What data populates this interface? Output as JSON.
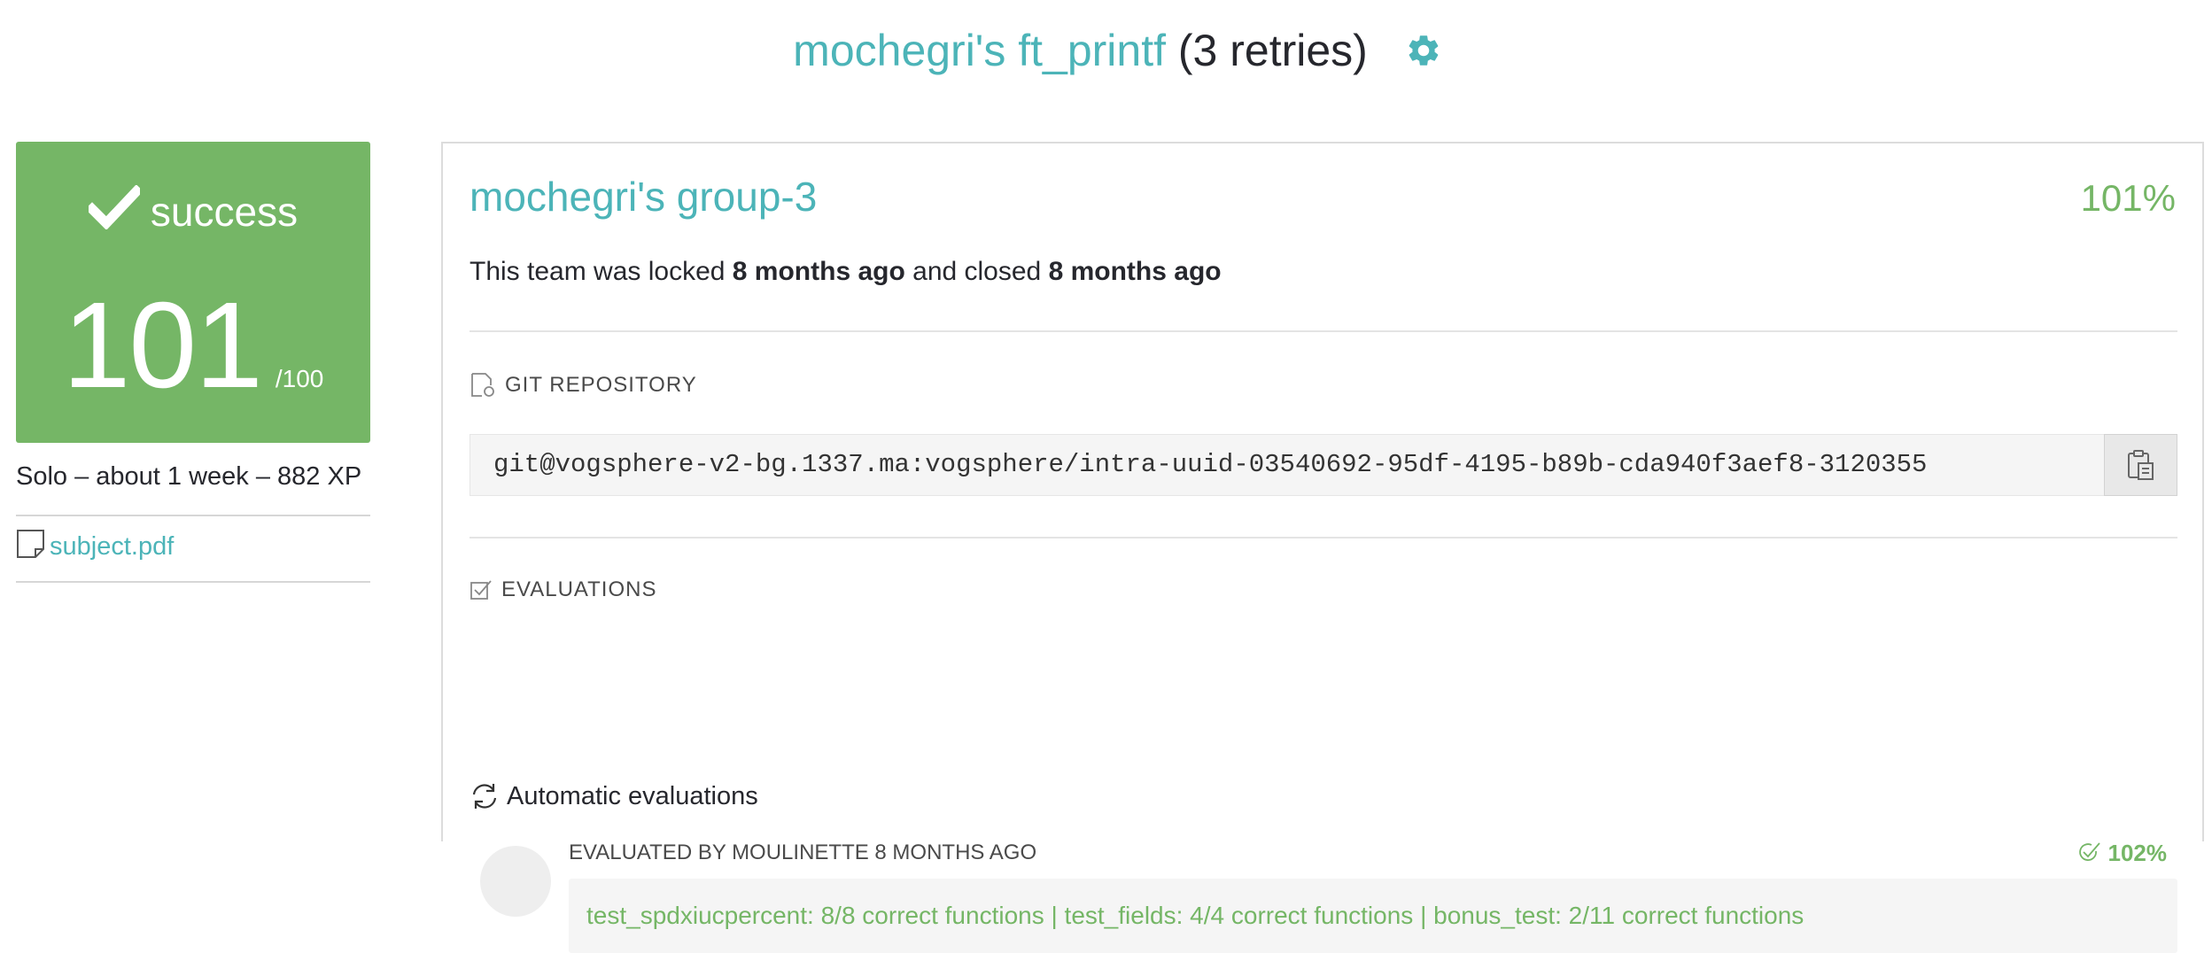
{
  "header": {
    "project_link": "mochegri's ft_printf",
    "retries": "(3 retries)",
    "settings_icon": "gear-icon",
    "accent_color": "#4cb4b8"
  },
  "status_card": {
    "status": "success",
    "status_icon": "checkmark-icon",
    "score": "101",
    "max_score": "/100",
    "background_color": "#75b666"
  },
  "project_info": {
    "summary": "Solo – about 1 week – 882 XP",
    "attachment_icon": "document-icon",
    "attachment_label": "subject.pdf"
  },
  "team": {
    "name": "mochegri's group-3",
    "final_percent": "101%",
    "status_prefix": "This team was locked ",
    "locked_time": "8 months ago",
    "status_middle": " and closed ",
    "closed_time": "8 months ago"
  },
  "git_section": {
    "heading": "GIT REPOSITORY",
    "heading_icon": "git-repo-icon",
    "repo_url": "git@vogsphere-v2-bg.1337.ma:vogsphere/intra-uuid-03540692-95df-4195-b89b-cda940f3aef8-3120355",
    "copy_icon": "clipboard-icon"
  },
  "evaluations_section": {
    "heading": "EVALUATIONS",
    "heading_icon": "checkbox-icon",
    "automatic_heading": "Automatic evaluations",
    "automatic_icon": "refresh-icon",
    "evaluation": {
      "evaluator_line": "EVALUATED BY MOULINETTE 8 MONTHS AGO",
      "score": "102%",
      "score_icon": "check-circle-icon",
      "result": "test_spdxiucpercent: 8/8 correct functions | test_fields: 4/4 correct functions | bonus_test: 2/11 correct functions",
      "success_color": "#75b666"
    }
  }
}
